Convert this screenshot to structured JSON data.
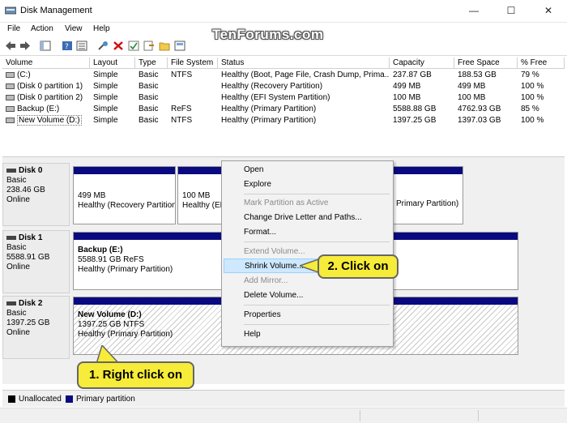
{
  "window": {
    "title": "Disk Management",
    "minimize_glyph": "—",
    "maximize_glyph": "☐",
    "close_glyph": "✕"
  },
  "watermark": "TenForums.com",
  "menu": [
    "File",
    "Action",
    "View",
    "Help"
  ],
  "toolbar": {
    "icons": [
      "back-arrow-icon",
      "forward-arrow-icon",
      "console-tree-icon",
      "help-icon",
      "properties-list-icon",
      "connect-icon",
      "delete-icon",
      "check-icon",
      "export-icon",
      "open-icon",
      "view-icon"
    ]
  },
  "table": {
    "columns": [
      "Volume",
      "Layout",
      "Type",
      "File System",
      "Status",
      "Capacity",
      "Free Space",
      "% Free"
    ],
    "rows": [
      [
        "(C:)",
        "Simple",
        "Basic",
        "NTFS",
        "Healthy (Boot, Page File, Crash Dump, Prima...",
        "237.87 GB",
        "188.53 GB",
        "79 %"
      ],
      [
        "(Disk 0 partition 1)",
        "Simple",
        "Basic",
        "",
        "Healthy (Recovery Partition)",
        "499 MB",
        "499 MB",
        "100 %"
      ],
      [
        "(Disk 0 partition 2)",
        "Simple",
        "Basic",
        "",
        "Healthy (EFI System Partition)",
        "100 MB",
        "100 MB",
        "100 %"
      ],
      [
        "Backup (E:)",
        "Simple",
        "Basic",
        "ReFS",
        "Healthy (Primary Partition)",
        "5588.88 GB",
        "4762.93 GB",
        "85 %"
      ],
      [
        "New Volume (D:)",
        "Simple",
        "Basic",
        "NTFS",
        "Healthy (Primary Partition)",
        "1397.25 GB",
        "1397.03 GB",
        "100 %"
      ]
    ]
  },
  "disks": [
    {
      "name": "Disk 0",
      "type": "Basic",
      "size": "238.46 GB",
      "state": "Online",
      "partitions": [
        {
          "size": "499 MB",
          "status": "Healthy (Recovery Partition)"
        },
        {
          "size": "100 MB",
          "status": "Healthy (EF"
        },
        {
          "status": "Primary Partition)"
        }
      ]
    },
    {
      "name": "Disk 1",
      "type": "Basic",
      "size": "5588.91 GB",
      "state": "Online",
      "partitions": [
        {
          "name": "Backup  (E:)",
          "size": "5588.91 GB ReFS",
          "status": "Healthy (Primary Partition)"
        }
      ]
    },
    {
      "name": "Disk 2",
      "type": "Basic",
      "size": "1397.25 GB",
      "state": "Online",
      "partitions": [
        {
          "name": "New Volume  (D:)",
          "size": "1397.25 GB NTFS",
          "status": "Healthy (Primary Partition)"
        }
      ]
    }
  ],
  "context_menu": {
    "items": [
      "Open",
      "Explore",
      "Mark Partition as Active",
      "Change Drive Letter and Paths...",
      "Format...",
      "Extend Volume...",
      "Shrink Volume...",
      "Add Mirror...",
      "Delete Volume...",
      "Properties",
      "Help"
    ],
    "disabled": [
      "Mark Partition as Active",
      "Extend Volume...",
      "Add Mirror..."
    ],
    "highlighted": "Shrink Volume..."
  },
  "callouts": {
    "right_click": "1. Right click on",
    "click_on": "2. Click on"
  },
  "legend": {
    "unallocated": "Unallocated",
    "primary": "Primary partition"
  },
  "colors": {
    "unallocated": "#000000",
    "primary": "#0a0a80",
    "callout": "#f6ec39",
    "highlight": "#cde8ff"
  }
}
